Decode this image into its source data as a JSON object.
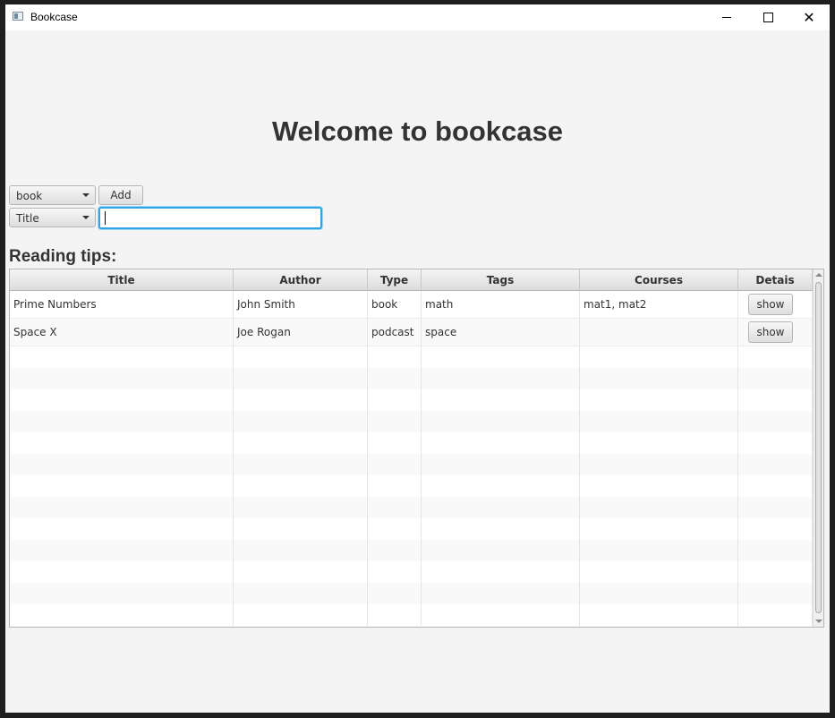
{
  "window": {
    "title": "Bookcase",
    "icon": "app-window-icon",
    "controls": {
      "minimize": "minimize-icon",
      "maximize": "maximize-icon",
      "close": "close-icon"
    }
  },
  "heading": "Welcome to bookcase",
  "form": {
    "type_select": {
      "value": "book"
    },
    "add_label": "Add",
    "field_select": {
      "value": "Title"
    },
    "text_input": {
      "value": "",
      "placeholder": ""
    }
  },
  "subheading": "Reading tips:",
  "table": {
    "columns": [
      "Title",
      "Author",
      "Type",
      "Tags",
      "Courses",
      "Detais"
    ],
    "rows": [
      {
        "title": "Prime Numbers",
        "author": "John Smith",
        "type": "book",
        "tags": "math",
        "courses": "mat1, mat2",
        "details_label": "show"
      },
      {
        "title": "Space X",
        "author": "Joe Rogan",
        "type": "podcast",
        "tags": "space",
        "courses": "",
        "details_label": "show"
      }
    ],
    "empty_rows": 13
  },
  "colors": {
    "accent": "#2fa4e7",
    "background": "#f4f4f4"
  }
}
